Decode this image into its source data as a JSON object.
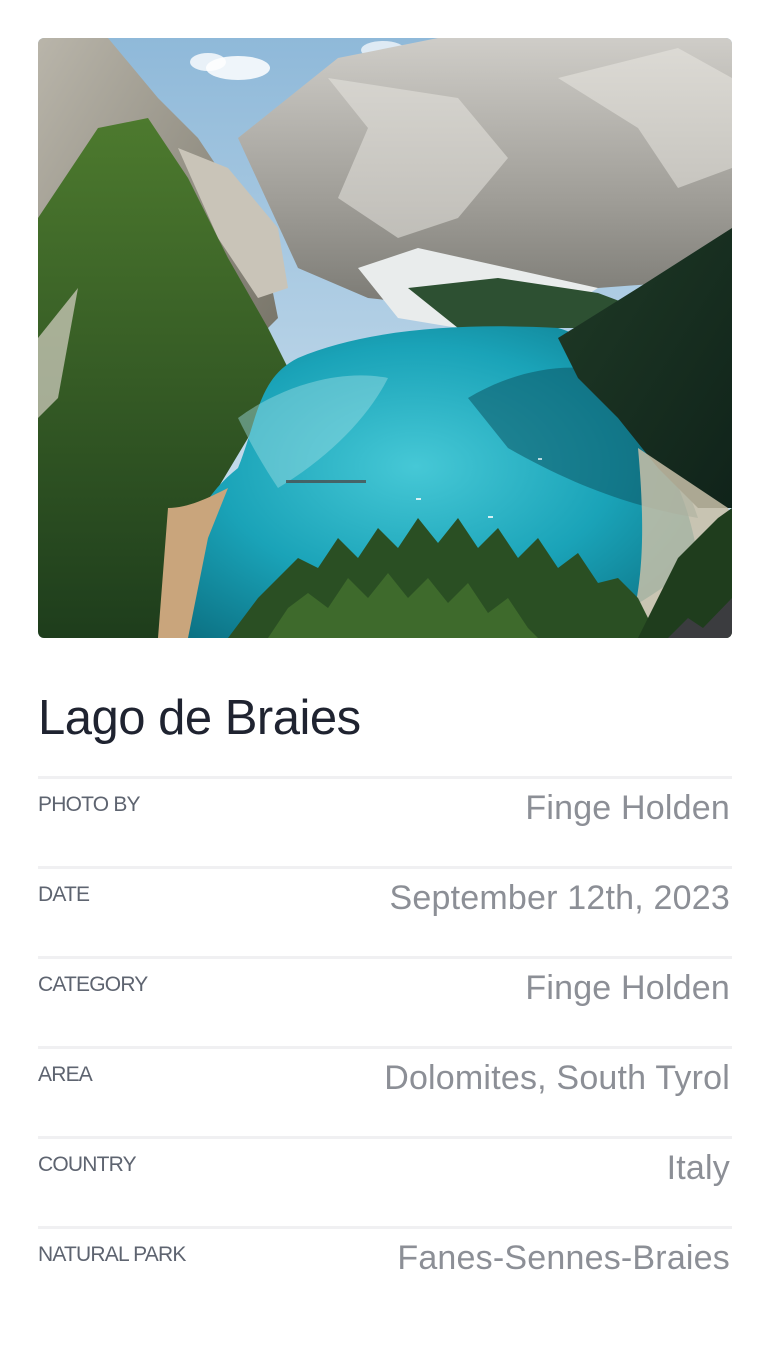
{
  "photo": {
    "subject": "lake-between-mountains-photo"
  },
  "title": "Lago de Braies",
  "details": [
    {
      "label": "PHOTO BY",
      "value": "Finge Holden"
    },
    {
      "label": "DATE",
      "value": "September 12th, 2023"
    },
    {
      "label": "CATEGORY",
      "value": "Finge Holden"
    },
    {
      "label": "AREA",
      "value": "Dolomites, South Tyrol"
    },
    {
      "label": "COUNTRY",
      "value": "Italy"
    },
    {
      "label": "NATURAL PARK",
      "value": "Fanes-Sennes-Braies"
    }
  ],
  "colors": {
    "title": "#1f2330",
    "label": "#5e6470",
    "value": "#8c8f96",
    "divider": "#f0f0f2",
    "lake": "#1aa3b8"
  }
}
